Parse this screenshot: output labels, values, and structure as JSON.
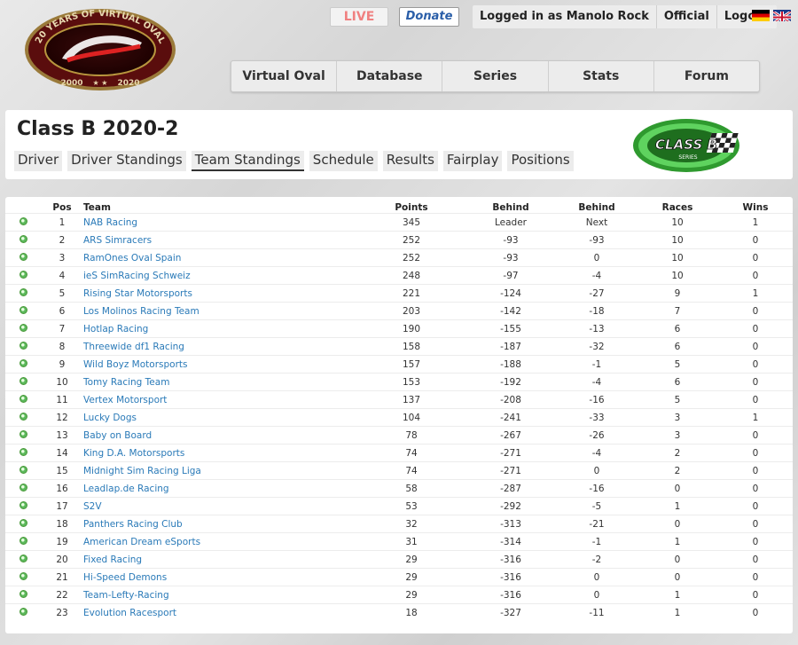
{
  "header": {
    "logo_text_top": "20 YEARS OF VIRTUAL OVAL",
    "logo_year_left": "2000",
    "logo_year_right": "2020",
    "live_label": "LIVE",
    "donate_label": "Donate",
    "user_menu": [
      "Logged in as Manolo Rock",
      "Official",
      "Logout"
    ],
    "flags": [
      "de-flag",
      "gb-flag"
    ]
  },
  "main_nav": [
    "Virtual Oval",
    "Database",
    "Series",
    "Stats",
    "Forum"
  ],
  "class_panel": {
    "title": "Class B 2020-2",
    "tabs": [
      "Driver",
      "Driver Standings",
      "Team Standings",
      "Schedule",
      "Results",
      "Fairplay",
      "Positions"
    ],
    "active_tab": "Team Standings",
    "logo_text": "CLASS B",
    "logo_subtext": "SERIES"
  },
  "standings": {
    "columns": [
      "Pos",
      "Team",
      "Points",
      "Behind",
      "Behind",
      "Races",
      "Wins"
    ],
    "rows": [
      {
        "pos": "1",
        "team": "NAB Racing",
        "points": "345",
        "behind_leader": "Leader",
        "behind_next": "Next",
        "races": "10",
        "wins": "1"
      },
      {
        "pos": "2",
        "team": "ARS Simracers",
        "points": "252",
        "behind_leader": "-93",
        "behind_next": "-93",
        "races": "10",
        "wins": "0"
      },
      {
        "pos": "3",
        "team": "RamOnes Oval Spain",
        "points": "252",
        "behind_leader": "-93",
        "behind_next": "0",
        "races": "10",
        "wins": "0"
      },
      {
        "pos": "4",
        "team": "ieS SimRacing Schweiz",
        "points": "248",
        "behind_leader": "-97",
        "behind_next": "-4",
        "races": "10",
        "wins": "0"
      },
      {
        "pos": "5",
        "team": "Rising Star Motorsports",
        "points": "221",
        "behind_leader": "-124",
        "behind_next": "-27",
        "races": "9",
        "wins": "1"
      },
      {
        "pos": "6",
        "team": "Los Molinos Racing Team",
        "points": "203",
        "behind_leader": "-142",
        "behind_next": "-18",
        "races": "7",
        "wins": "0"
      },
      {
        "pos": "7",
        "team": "Hotlap Racing",
        "points": "190",
        "behind_leader": "-155",
        "behind_next": "-13",
        "races": "6",
        "wins": "0"
      },
      {
        "pos": "8",
        "team": "Threewide df1 Racing",
        "points": "158",
        "behind_leader": "-187",
        "behind_next": "-32",
        "races": "6",
        "wins": "0"
      },
      {
        "pos": "9",
        "team": "Wild Boyz Motorsports",
        "points": "157",
        "behind_leader": "-188",
        "behind_next": "-1",
        "races": "5",
        "wins": "0"
      },
      {
        "pos": "10",
        "team": "Tomy Racing Team",
        "points": "153",
        "behind_leader": "-192",
        "behind_next": "-4",
        "races": "6",
        "wins": "0"
      },
      {
        "pos": "11",
        "team": "Vertex Motorsport",
        "points": "137",
        "behind_leader": "-208",
        "behind_next": "-16",
        "races": "5",
        "wins": "0"
      },
      {
        "pos": "12",
        "team": "Lucky Dogs",
        "points": "104",
        "behind_leader": "-241",
        "behind_next": "-33",
        "races": "3",
        "wins": "1"
      },
      {
        "pos": "13",
        "team": "Baby on Board",
        "points": "78",
        "behind_leader": "-267",
        "behind_next": "-26",
        "races": "3",
        "wins": "0"
      },
      {
        "pos": "14",
        "team": "King D.A. Motorsports",
        "points": "74",
        "behind_leader": "-271",
        "behind_next": "-4",
        "races": "2",
        "wins": "0"
      },
      {
        "pos": "15",
        "team": "Midnight Sim Racing Liga",
        "points": "74",
        "behind_leader": "-271",
        "behind_next": "0",
        "races": "2",
        "wins": "0"
      },
      {
        "pos": "16",
        "team": "Leadlap.de Racing",
        "points": "58",
        "behind_leader": "-287",
        "behind_next": "-16",
        "races": "0",
        "wins": "0"
      },
      {
        "pos": "17",
        "team": "S2V",
        "points": "53",
        "behind_leader": "-292",
        "behind_next": "-5",
        "races": "1",
        "wins": "0"
      },
      {
        "pos": "18",
        "team": "Panthers Racing Club",
        "points": "32",
        "behind_leader": "-313",
        "behind_next": "-21",
        "races": "0",
        "wins": "0"
      },
      {
        "pos": "19",
        "team": "American Dream eSports",
        "points": "31",
        "behind_leader": "-314",
        "behind_next": "-1",
        "races": "1",
        "wins": "0"
      },
      {
        "pos": "20",
        "team": "Fixed Racing",
        "points": "29",
        "behind_leader": "-316",
        "behind_next": "-2",
        "races": "0",
        "wins": "0"
      },
      {
        "pos": "21",
        "team": "Hi-Speed Demons",
        "points": "29",
        "behind_leader": "-316",
        "behind_next": "0",
        "races": "0",
        "wins": "0"
      },
      {
        "pos": "22",
        "team": "Team-Lefty-Racing",
        "points": "29",
        "behind_leader": "-316",
        "behind_next": "0",
        "races": "1",
        "wins": "0"
      },
      {
        "pos": "23",
        "team": "Evolution Racesport",
        "points": "18",
        "behind_leader": "-327",
        "behind_next": "-11",
        "races": "1",
        "wins": "0"
      }
    ]
  },
  "colors": {
    "link": "#2a7ab8",
    "live": "#f08080",
    "donate": "#2a5ea8",
    "status_dot": "#5cb85c",
    "class_logo_green": "#3cb043"
  }
}
